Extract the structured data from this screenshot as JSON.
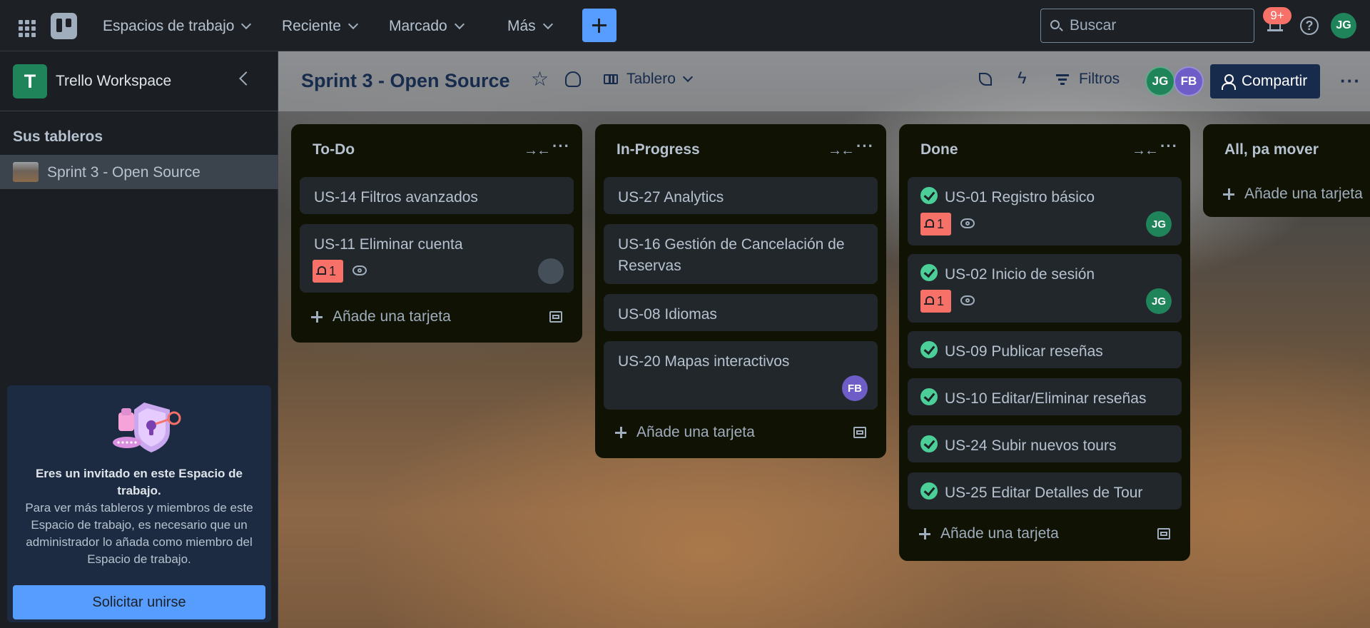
{
  "header": {
    "nav": [
      "Espacios de trabajo",
      "Reciente",
      "Marcado",
      "Más"
    ],
    "search_placeholder": "Buscar",
    "notifications_count": "9+",
    "help_glyph": "?",
    "user_initials": "JG",
    "create_icon": "plus-icon",
    "apps_icon": "app-switcher-icon",
    "accent_color": "#579dff"
  },
  "sidebar": {
    "workspace_initial": "T",
    "workspace_name": "Trello Workspace",
    "boards_title": "Sus tableros",
    "boards": [
      "Sprint 3 - Open Source"
    ],
    "invite": {
      "title": "Eres un invitado en este Espacio de trabajo.",
      "text": "Para ver más tableros y miembros de este Espacio de trabajo, es necesario que un administrador lo añada como miembro del Espacio de trabajo.",
      "button": "Solicitar unirse"
    }
  },
  "board": {
    "title": "Sprint 3 - Open Source",
    "view": "Tablero",
    "filters_label": "Filtros",
    "members": [
      "JG",
      "FB"
    ],
    "share_label": "Compartir",
    "add_card_label": "Añade una tarjeta",
    "lists": [
      {
        "title": "To-Do",
        "cards": [
          {
            "title": "US-14 Filtros avanzados"
          },
          {
            "title": "US-11 Eliminar cuenta",
            "notifications": "1",
            "watching": true
          }
        ]
      },
      {
        "title": "In-Progress",
        "cards": [
          {
            "title": "US-27 Analytics"
          },
          {
            "title": "US-16 Gestión de Cancelación de Reservas"
          },
          {
            "title": "US-08 Idiomas"
          },
          {
            "title": "US-20 Mapas interactivos",
            "member": "FB"
          }
        ]
      },
      {
        "title": "Done",
        "cards": [
          {
            "title": "US-01 Registro básico",
            "done": true,
            "notifications": "1",
            "watching": true,
            "member": "JG"
          },
          {
            "title": "US-02 Inicio de sesión",
            "done": true,
            "notifications": "1",
            "watching": true,
            "member": "JG"
          },
          {
            "title": "US-09 Publicar reseñas",
            "done": true
          },
          {
            "title": "US-10 Editar/Eliminar reseñas",
            "done": true
          },
          {
            "title": "US-24 Subir nuevos tours",
            "done": true
          },
          {
            "title": "US-25 Editar Detalles de Tour",
            "done": true
          }
        ]
      },
      {
        "title": "All, pa mover",
        "cards": []
      }
    ]
  },
  "colors": {
    "member_jg": "#1f845a",
    "member_fb": "#6e5dc6",
    "due_badge": "#f87168",
    "complete_check": "#4bce97",
    "share_button": "#172b4d"
  }
}
